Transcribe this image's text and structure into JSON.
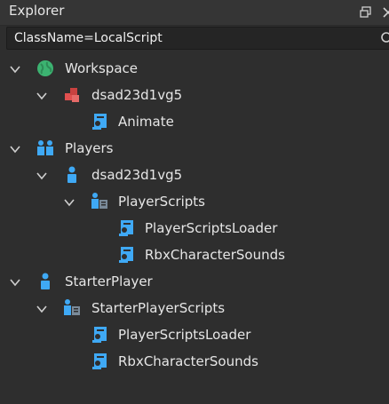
{
  "panel": {
    "title": "Explorer"
  },
  "search": {
    "value": "ClassName=LocalScript"
  },
  "tree": {
    "workspace": "Workspace",
    "workspace_model": "dsad23d1vg5",
    "animate": "Animate",
    "players": "Players",
    "player": "dsad23d1vg5",
    "player_scripts": "PlayerScripts",
    "ps_loader": "PlayerScriptsLoader",
    "ps_sounds": "RbxCharacterSounds",
    "starter_player": "StarterPlayer",
    "starter_player_scripts": "StarterPlayerScripts",
    "sps_loader": "PlayerScriptsLoader",
    "sps_sounds": "RbxCharacterSounds"
  },
  "colors": {
    "background": "#2e2e2e",
    "titlebar": "#353535",
    "search_bg": "#252525",
    "text": "#e6e6e6",
    "script_icon": "#3fa9f5",
    "model_icon": "#e0504f",
    "workspace_icon": "#3cb371"
  }
}
